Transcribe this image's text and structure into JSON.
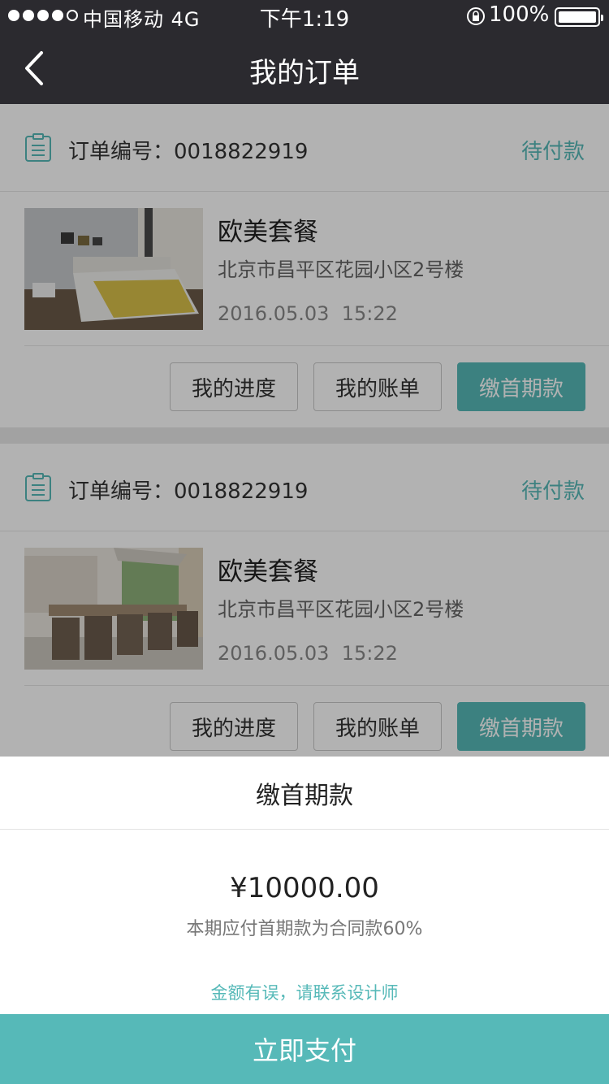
{
  "status_bar": {
    "carrier": "中国移动",
    "network": "4G",
    "time": "下午1:19",
    "battery": "100%"
  },
  "nav": {
    "title": "我的订单",
    "back_icon": "chevron-left-icon"
  },
  "orders": [
    {
      "order_label": "订单编号：",
      "order_no": "0018822919",
      "status": "待付款",
      "package_name": "欧美套餐",
      "address": "北京市昌平区花园小区2号楼",
      "date": "2016.05.03",
      "time": "15:22",
      "image": "bedroom-photo",
      "actions": [
        "我的进度",
        "我的账单",
        "缴首期款"
      ]
    },
    {
      "order_label": "订单编号：",
      "order_no": "0018822919",
      "status": "待付款",
      "package_name": "欧美套餐",
      "address": "北京市昌平区花园小区2号楼",
      "date": "2016.05.03",
      "time": "15:22",
      "image": "dining-room-photo",
      "actions": [
        "我的进度",
        "我的账单",
        "缴首期款"
      ]
    }
  ],
  "sheet": {
    "title": "缴首期款",
    "amount": "¥10000.00",
    "note": "本期应付首期款为合同款60%",
    "contact_link": "金额有误，请联系设计师",
    "pay_button": "立即支付"
  },
  "colors": {
    "accent": "#56b9b8",
    "topbar": "#2b2a2f"
  }
}
